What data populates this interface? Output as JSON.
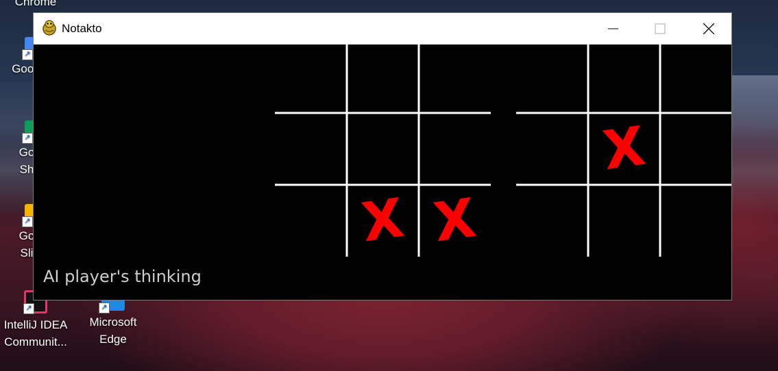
{
  "desktop": {
    "icons": [
      {
        "label": "Chrome",
        "color": "#e0e0e0"
      },
      {
        "label": "Goog",
        "color": "#4285f4"
      },
      {
        "label": "Go Sh",
        "color": "#0f9d58"
      },
      {
        "label": "Go Sli",
        "color": "#f4b400"
      },
      {
        "label": "IntelliJ IDEA Communit...",
        "color": "#e8336b"
      },
      {
        "label": "Microsoft Edge",
        "color": "#1e88e5"
      }
    ]
  },
  "window": {
    "title": "Notakto",
    "controls": {
      "minimize": "minimize-icon",
      "maximize": "maximize-icon",
      "close": "close-icon"
    }
  },
  "game": {
    "status_text": "AI player's thinking",
    "grid_color": "#ffffff",
    "mark_color": "#ff0000",
    "mark_symbol": "X",
    "boards": [
      {
        "marks": [
          7,
          8
        ]
      },
      {
        "marks": [
          4
        ]
      }
    ]
  }
}
